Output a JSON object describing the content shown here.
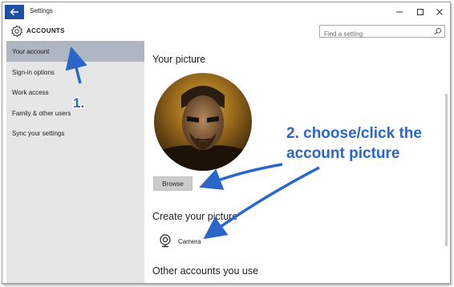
{
  "window": {
    "title": "Settings"
  },
  "header": {
    "title": "ACCOUNTS",
    "search_placeholder": "Find a setting"
  },
  "sidebar": {
    "items": [
      {
        "label": "Your account",
        "active": true
      },
      {
        "label": "Sign-in options",
        "active": false
      },
      {
        "label": "Work access",
        "active": false
      },
      {
        "label": "Family & other users",
        "active": false
      },
      {
        "label": "Sync your settings",
        "active": false
      }
    ]
  },
  "main": {
    "picture_title": "Your picture",
    "browse_label": "Browse",
    "create_title": "Create your picture",
    "camera_label": "Camera",
    "other_title": "Other accounts you use"
  },
  "annotations": {
    "step1": "1.",
    "step2_line1": "2. choose/click the",
    "step2_line2": "account picture",
    "color": "#2a67c9"
  },
  "colors": {
    "back_button": "#1e4fa3",
    "sidebar_bg": "#e6e6e6",
    "sidebar_active": "#aeb6c2",
    "browse_bg": "#cccccc"
  }
}
